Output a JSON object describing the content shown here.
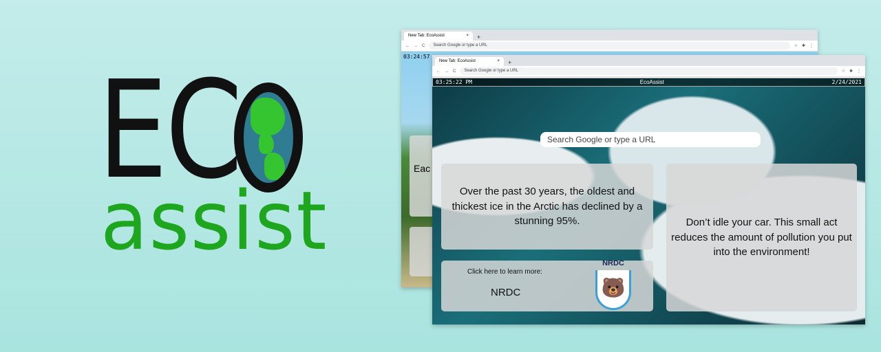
{
  "logo": {
    "eco": "EC",
    "assist": "assist",
    "colors": {
      "eco": "#111111",
      "assist": "#1ea71e",
      "globe_land": "#35c530",
      "globe_ocean": "#2f7c93"
    }
  },
  "back_window": {
    "tab_title": "New Tab: EcoAssist",
    "omnibox_placeholder": "Search Google or type a URL",
    "time": "03:24:57",
    "card_text": "Eac"
  },
  "front_window": {
    "tab_title": "New Tab: EcoAssist",
    "omnibox_placeholder": "Search Google or type a URL",
    "time": "03:25:22 PM",
    "app_name": "EcoAssist",
    "date": "2/24/2021",
    "search_placeholder": "Search Google or type a URL",
    "fact": "Over the past 30 years, the oldest and thickest ice in the Arctic has declined by a stunning 95%.",
    "tip": "Don’t idle your car. This small act reduces the amount of pollution you put into the environment!",
    "learn_more": "Click here to learn more:",
    "org_link": "NRDC",
    "org_logo_text": "NRDC"
  }
}
